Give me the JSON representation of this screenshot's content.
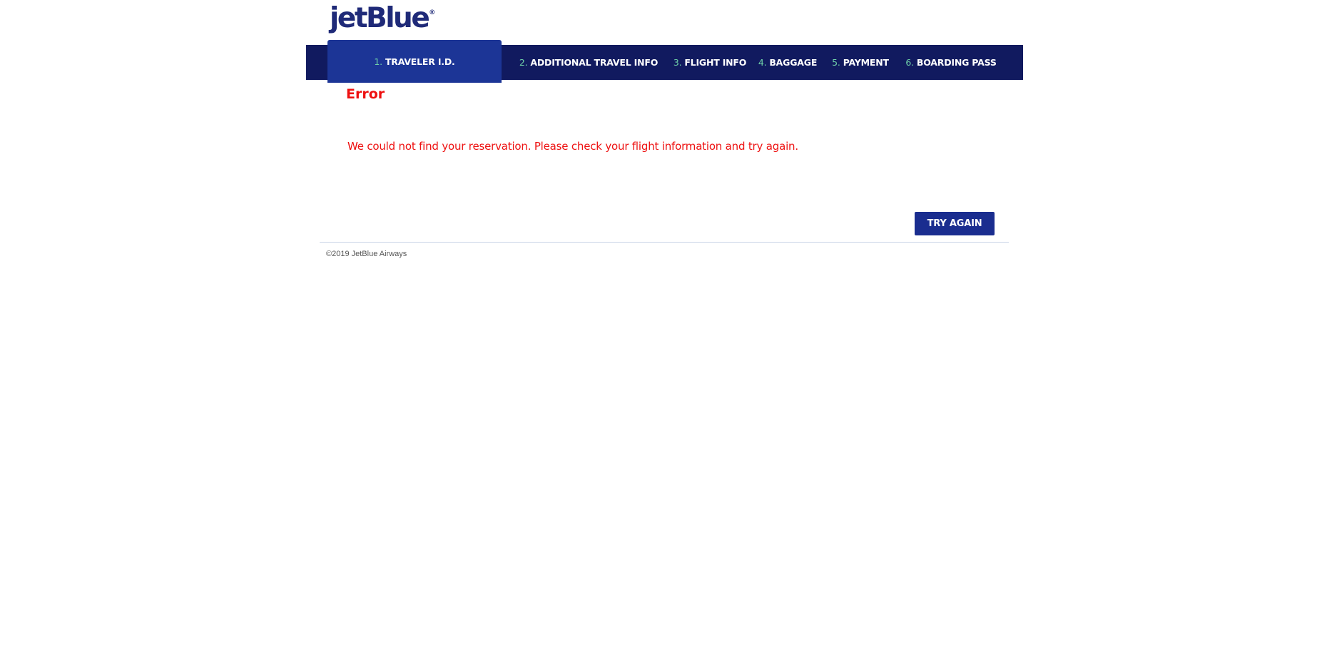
{
  "brand": {
    "logo_text": "jetBlue",
    "logo_mark": "®"
  },
  "steps": [
    {
      "num": "1.",
      "label": "TRAVELER I.D.",
      "active": true
    },
    {
      "num": "2.",
      "label": "ADDITIONAL TRAVEL INFO",
      "active": false
    },
    {
      "num": "3.",
      "label": "FLIGHT INFO",
      "active": false
    },
    {
      "num": "4.",
      "label": "BAGGAGE",
      "active": false
    },
    {
      "num": "5.",
      "label": "PAYMENT",
      "active": false
    },
    {
      "num": "6.",
      "label": "BOARDING PASS",
      "active": false
    }
  ],
  "error": {
    "title": "Error",
    "message": "We could not find your reservation. Please check your flight information and try again."
  },
  "actions": {
    "try_again_label": "TRY AGAIN"
  },
  "footer": {
    "copyright": "©2019 JetBlue Airways"
  },
  "colors": {
    "navbar": "#111a5f",
    "active_step": "#1c3596",
    "step_number": "#6fd0a8",
    "error": "#ee1111",
    "button": "#1a2d8f"
  }
}
